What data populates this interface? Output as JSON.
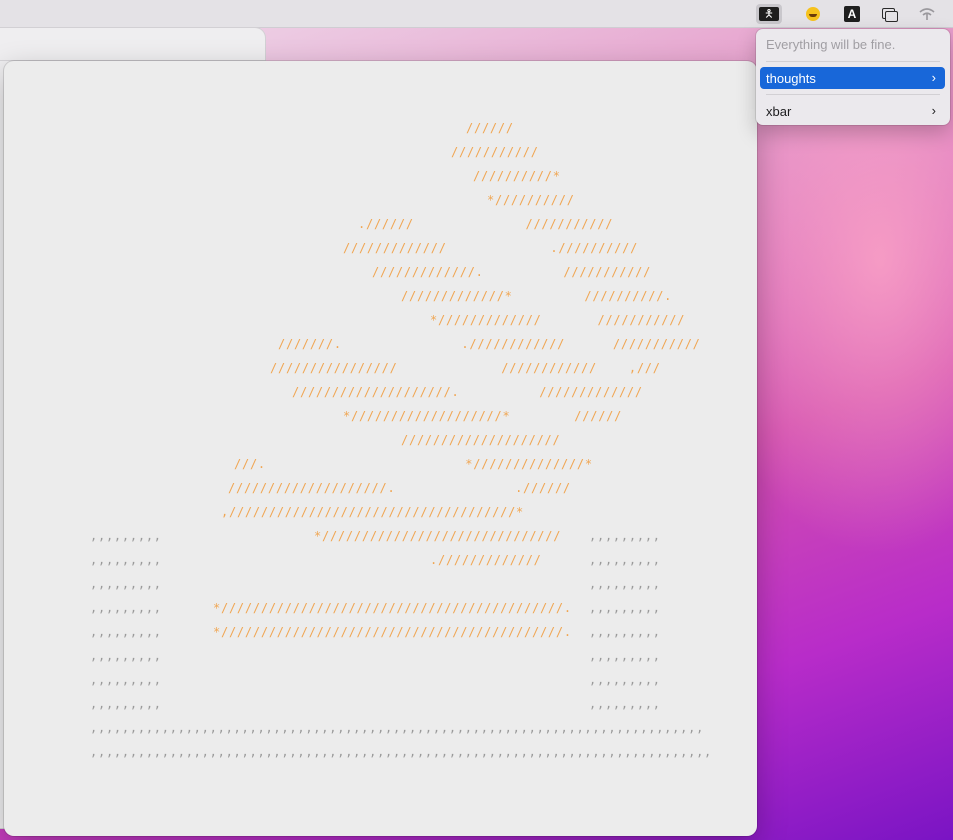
{
  "menubar": {
    "icons": [
      "xbar-stick-figure-icon",
      "emoji-face-icon",
      "input-source-icon",
      "stage-manager-icon",
      "wifi-icon"
    ],
    "input_source_letter": "A"
  },
  "menu": {
    "message": "Everything will be fine.",
    "items": [
      {
        "label": "thoughts",
        "chevron": "›",
        "highlighted": true
      },
      {
        "label": "xbar",
        "chevron": "›",
        "highlighted": false
      }
    ],
    "highlight_color": "#1867d9"
  },
  "ascii_art": {
    "colors": {
      "orange": "#f0a653",
      "grey": "#9a9a9a"
    },
    "lines": [
      "//////",
      "///////////",
      "//////////*",
      "*//////////",
      ".//////              ///////////",
      "/////////////             .//////////",
      "/////////////.          ///////////",
      "/////////////*         //////////.",
      "*/////////////       ///////////",
      "///////.               .////////////      ///////////",
      "////////////////             ////////////    ,///",
      "////////////////////.          /////////////",
      "*///////////////////*        //////",
      "////////////////////",
      "///.                         *//////////////*",
      "////////////////////.               .//////",
      ",////////////////////////////////////*",
      "*//////////////////////////////",
      "./////////////",
      "*///////////////////////////////////////////.",
      "*///////////////////////////////////////////.",
      ",,,,,,,,,",
      ",,,,,,,,,",
      ",,,,,,,,,",
      ",,,,,,,,,",
      ",,,,,,,,,",
      ",,,,,,,,,",
      ",,,,,,,,,",
      ",,,,,,,,,",
      ",,,,,,,,,",
      ",,,,,,,,,",
      ",,,,,,,,,",
      ",,,,,,,,,",
      ",,,,,,,,,",
      ",,,,,,,,,",
      ",,,,,,,,,",
      ",,,,,,,,,",
      ",,,,,,,,,,,,,,,,,,,,,,,,,,,,,,,,,,,,,,,,,,,,,,,,,,,,,,,,,,,,,,,,,,,,,,,,,,,,,",
      ",,,,,,,,,,,,,,,,,,,,,,,,,,,,,,,,,,,,,,,,,,,,,,,,,,,,,,,,,,,,,,,,,,,,,,,,,,,,,,"
    ]
  }
}
